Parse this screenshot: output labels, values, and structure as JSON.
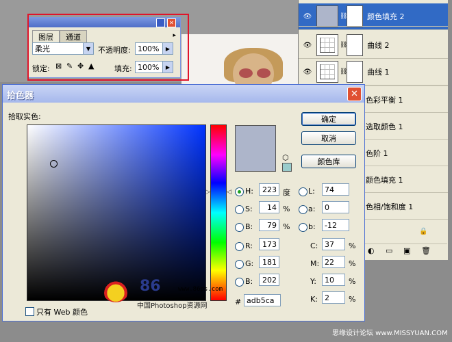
{
  "layers_panel": {
    "layers": [
      {
        "name": "颜色填充 2",
        "thumb": "fill",
        "selected": true,
        "visible": true,
        "mask": true
      },
      {
        "name": "曲线 2",
        "thumb": "curve",
        "selected": false,
        "visible": true,
        "mask": true
      },
      {
        "name": "曲线 1",
        "thumb": "curve",
        "selected": false,
        "visible": true,
        "mask": true
      },
      {
        "name": "色彩平衡 1"
      },
      {
        "name": "选取颜色 1"
      },
      {
        "name": "色阶 1"
      },
      {
        "name": "颜色填充 1"
      },
      {
        "name": "色相/饱和度 1"
      }
    ]
  },
  "mini_palette": {
    "tab_layers": "图层",
    "tab_channels": "通道",
    "blend_mode": "柔光",
    "opacity_label": "不透明度:",
    "opacity_value": "100%",
    "lock_label": "锁定:",
    "fill_label": "填充:",
    "fill_value": "100%"
  },
  "color_picker": {
    "title": "拾色器",
    "subtitle": "拾取实色:",
    "ok_button": "确定",
    "cancel_button": "取消",
    "library_button": "颜色库",
    "hsb": {
      "h_label": "H:",
      "h_value": "223",
      "h_unit": "度",
      "s_label": "S:",
      "s_value": "14",
      "s_unit": "%",
      "b_label": "B:",
      "b_value": "79",
      "b_unit": "%"
    },
    "lab": {
      "l_label": "L:",
      "l_value": "74",
      "a_label": "a:",
      "a_value": "0",
      "b_label": "b:",
      "b_value": "-12"
    },
    "rgb": {
      "r_label": "R:",
      "r_value": "173",
      "g_label": "G:",
      "g_value": "181",
      "b_label": "B:",
      "b_value": "202"
    },
    "cmyk": {
      "c_label": "C:",
      "c_value": "37",
      "m_label": "M:",
      "m_value": "22",
      "y_label": "Y:",
      "y_value": "10",
      "k_label": "K:",
      "k_value": "2",
      "unit": "%"
    },
    "hex_label": "#",
    "hex_value": "adb5ca",
    "web_only_label": "只有 Web 颜色",
    "current_color": "#adb5ca",
    "web_safe_color": "#99cccc"
  },
  "watermark": {
    "site": "www.86ps.com",
    "caption": "中国Photoshop资源网",
    "brand": "86"
  },
  "footer_watermark": "思缘设计论坛  www.MISSYUAN.COM"
}
